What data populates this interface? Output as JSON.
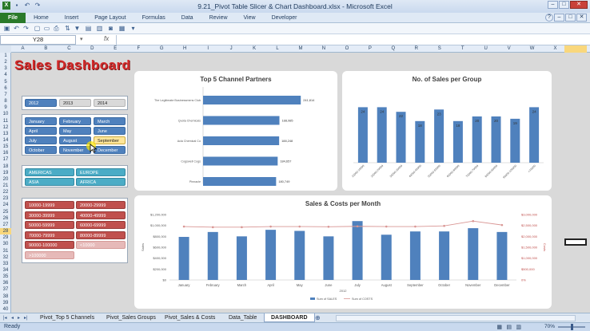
{
  "window": {
    "title": "9.21_Pivot Table Slicer & Chart Dashboard.xlsx - Microsoft Excel",
    "buttons": [
      "–",
      "□",
      "✕"
    ]
  },
  "ribbon": {
    "tabs": [
      "File",
      "Home",
      "Insert",
      "Page Layout",
      "Formulas",
      "Data",
      "Review",
      "View",
      "Developer"
    ]
  },
  "formula_bar": {
    "name_box": "Y28",
    "fx": "fx",
    "value": ""
  },
  "columns": [
    "A",
    "B",
    "C",
    "D",
    "E",
    "F",
    "G",
    "H",
    "I",
    "J",
    "K",
    "L",
    "M",
    "N",
    "O",
    "P",
    "Q",
    "R",
    "S",
    "T",
    "U",
    "V",
    "W",
    "X",
    "Y"
  ],
  "rows": [
    "1",
    "2",
    "3",
    "4",
    "5",
    "6",
    "7",
    "8",
    "9",
    "10",
    "11",
    "12",
    "13",
    "14",
    "15",
    "16",
    "17",
    "18",
    "19",
    "20",
    "21",
    "22",
    "23",
    "24",
    "25",
    "26",
    "27",
    "28",
    "29",
    "30",
    "31",
    "32",
    "33",
    "34",
    "35",
    "36",
    "37",
    "38",
    "39",
    "40"
  ],
  "dashboard_title": "Sales Dashboard",
  "slicers": {
    "years": [
      "2012",
      "2013",
      "2014"
    ],
    "months": [
      "January",
      "February",
      "March",
      "April",
      "May",
      "June",
      "July",
      "August",
      "September",
      "October",
      "November",
      "December"
    ],
    "regions": [
      "AMERICAS",
      "EUROPE",
      "ASIA",
      "AFRICA"
    ],
    "groups": [
      "10000-19999",
      "20000-29999",
      "30000-39999",
      "40000-49999",
      "50000-59999",
      "60000-69999",
      "70000-79999",
      "80000-89999",
      "90000-100000",
      "<10000",
      ">100000"
    ]
  },
  "charts": [
    {
      "title": "Top 5 Channel Partners",
      "type": "bar",
      "orientation": "horizontal",
      "categories": [
        "The Legitimate Businessmens Club",
        "Quota Chemicals",
        "Acia Chemical Co",
        "Cogswell Cogs",
        "Pinnacle"
      ],
      "values": [
        241814,
        188985,
        188248,
        184657,
        180749
      ],
      "value_labels": [
        "241,814",
        "188,985",
        "188,248",
        "184,657",
        "180,749"
      ],
      "color": "#4f81bd"
    },
    {
      "title": "No. of Sales per Group",
      "type": "bar",
      "orientation": "vertical",
      "categories": [
        "10000-19999",
        "20000-29999",
        "30000-39999",
        "40000-49999",
        "50000-59999",
        "60000-69999",
        "70000-79999",
        "80000-89999",
        "90000-100000",
        "<10000"
      ],
      "values": [
        24,
        24,
        22,
        18,
        23,
        18,
        20,
        20,
        19,
        24
      ],
      "ylim": [
        0,
        30
      ],
      "color": "#4f81bd"
    },
    {
      "title": "Sales & Costs per Month",
      "type": "bar",
      "categories": [
        "January",
        "February",
        "March",
        "April",
        "May",
        "June",
        "July",
        "August",
        "September",
        "October",
        "November",
        "December"
      ],
      "xlabel": "2012",
      "ylabel": "Sales",
      "y2label": "Costs",
      "left_ticks": [
        "$0",
        "$200,000",
        "$400,000",
        "$600,000",
        "$800,000",
        "$1,000,000",
        "$1,200,000"
      ],
      "right_ticks": [
        "0%",
        "$500,000",
        "$1,000,000",
        "$1,500,000",
        "$2,000,000",
        "$2,500,000",
        "$3,000,000"
      ],
      "ylim": [
        0,
        1200000
      ],
      "y2lim": [
        0,
        3000000
      ],
      "series": [
        {
          "name": "Sum of SALES",
          "type": "bar",
          "color": "#4f81bd",
          "values": [
            790000,
            880000,
            800000,
            920000,
            900000,
            800000,
            1080000,
            830000,
            890000,
            890000,
            950000,
            880000
          ]
        },
        {
          "name": "Sum of COSTS",
          "type": "line",
          "color": "#d99694",
          "values": [
            2450000,
            2420000,
            2420000,
            2450000,
            2450000,
            2440000,
            2460000,
            2450000,
            2450000,
            2480000,
            2700000,
            2520000
          ]
        }
      ]
    }
  ],
  "sheet_tabs": [
    "Pivot_Top 5 Channels",
    "Pivot_Sales Groups",
    "Pivot_Sales & Costs",
    "Data_Table",
    "DASHBOARD"
  ],
  "active_sheet": "DASHBOARD",
  "status": {
    "ready": "Ready",
    "zoom": "70%"
  }
}
